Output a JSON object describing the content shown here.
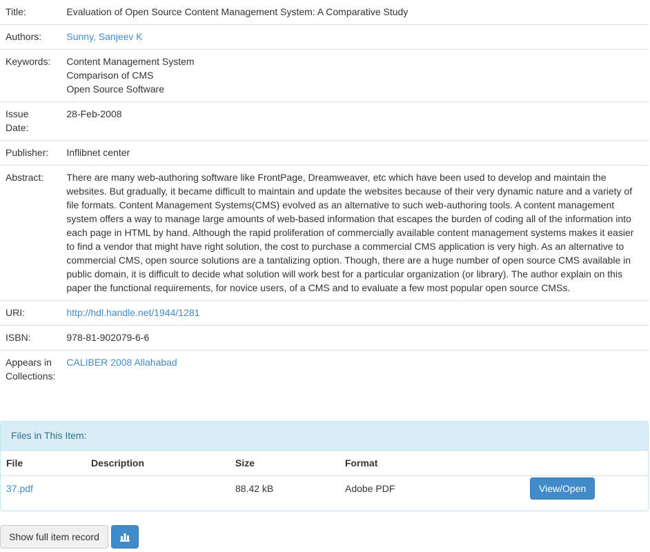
{
  "metadata": {
    "title_label": "Title:",
    "title_value": "Evaluation of Open Source Content Management System: A Comparative Study",
    "authors_label": "Authors:",
    "authors_value": "Sunny, Sanjeev K",
    "keywords_label": "Keywords:",
    "keywords": [
      "Content Management System",
      "Comparison of CMS",
      "Open Source Software"
    ],
    "issue_date_label_1": "Issue",
    "issue_date_label_2": "Date:",
    "issue_date_value": "28-Feb-2008",
    "publisher_label": "Publisher:",
    "publisher_value": "Inflibnet center",
    "abstract_label": "Abstract:",
    "abstract_value": "There are many web-authoring software like FrontPage, Dreamweaver, etc which have been used to develop and maintain the websites. But gradually, it became difficult to maintain and update the websites because of their very dynamic nature and a variety of file formats. Content Management Systems(CMS) evolved as an alternative to such web-authoring tools. A content management system offers a way to manage large amounts of web-based information that escapes the burden of coding all of the information into each page in HTML by hand. Although the rapid proliferation of commercially available content management systems makes it easier to find a vendor that might have right solution, the cost to purchase a commercial CMS application is very high. As an alternative to commercial CMS, open source solutions are a tantalizing option. Though, there are a huge number of open source CMS available in public domain, it is difficult to decide what solution will work best for a particular organization (or library). The author explain on this paper the functional requirements, for novice users, of a CMS and to evaluate a few most popular open source CMSs.",
    "uri_label": "URI:",
    "uri_value": "http://hdl.handle.net/1944/1281",
    "isbn_label": "ISBN:",
    "isbn_value": "978-81-902079-6-6",
    "collections_label_1": "Appears in",
    "collections_label_2": "Collections:",
    "collections_value": "CALIBER 2008 Allahabad"
  },
  "files": {
    "heading": "Files in This Item:",
    "columns": [
      "File",
      "Description",
      "Size",
      "Format"
    ],
    "rows": [
      {
        "file": "37.pdf",
        "description": "",
        "size": "88.42 kB",
        "format": "Adobe PDF",
        "action": "View/Open"
      }
    ]
  },
  "actions": {
    "full_record_label": "Show full item record",
    "stats_icon": "bar-chart-icon"
  },
  "colors": {
    "link": "#428bca",
    "primary_button": "#428bca",
    "panel_heading_bg": "#d9edf7",
    "panel_heading_text": "#31708f"
  }
}
